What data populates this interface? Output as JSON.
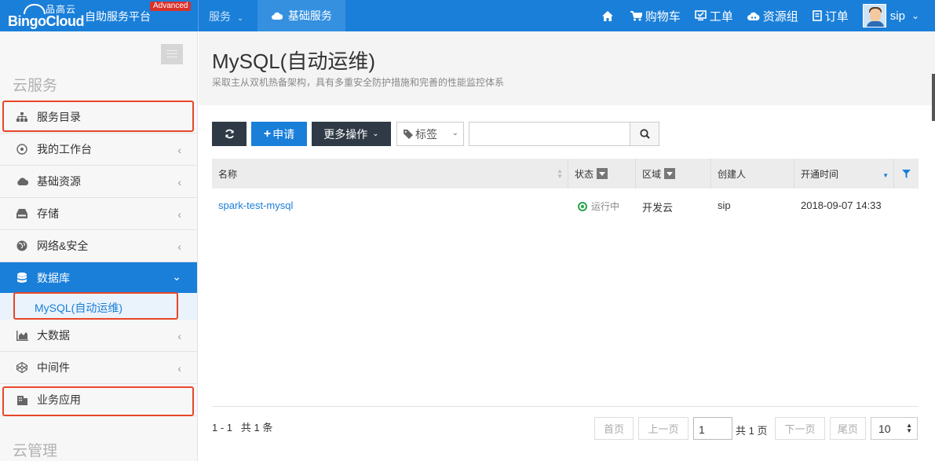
{
  "header": {
    "logo_cn": "品高云",
    "logo_en": "BingoCloud",
    "platform_title": "自助服务平台",
    "badge": "Advanced",
    "nav_services": "服务",
    "nav_basic": "基础服务",
    "cart": "购物车",
    "ticket": "工单",
    "resource_group": "资源组",
    "order": "订单",
    "user": "sip"
  },
  "sidebar": {
    "section_cloud_service": "云服务",
    "section_cloud_manage": "云管理",
    "items": [
      {
        "label": "服务目录",
        "icon": "sitemap-icon"
      },
      {
        "label": "我的工作台",
        "icon": "dashboard-icon"
      },
      {
        "label": "基础资源",
        "icon": "cloud-icon"
      },
      {
        "label": "存储",
        "icon": "storage-icon"
      },
      {
        "label": "网络&安全",
        "icon": "globe-icon"
      },
      {
        "label": "数据库",
        "icon": "database-icon"
      },
      {
        "label": "大数据",
        "icon": "chart-area-icon"
      },
      {
        "label": "中间件",
        "icon": "codepen-icon"
      },
      {
        "label": "业务应用",
        "icon": "building-icon"
      }
    ],
    "sub_item": "MySQL(自动运维)"
  },
  "page": {
    "title": "MySQL(自动运维)",
    "subtitle": "采取主从双机热备架构，具有多重安全防护措施和完善的性能监控体系"
  },
  "toolbar": {
    "apply": "申请",
    "more": "更多操作",
    "tag": "标签",
    "search_value": ""
  },
  "table": {
    "headers": {
      "name": "名称",
      "status": "状态",
      "region": "区域",
      "creator": "创建人",
      "time": "开通时间"
    },
    "rows": [
      {
        "name": "spark-test-mysql",
        "status": "运行中",
        "region": "开发云",
        "creator": "sip",
        "time": "2018-09-07 14:33"
      }
    ]
  },
  "pagination": {
    "range": "1 - 1",
    "total_items": "共 1 条",
    "first": "首页",
    "prev": "上一页",
    "page_value": "1",
    "total_pages": "共 1 页",
    "next": "下一页",
    "last": "尾页",
    "page_size": "10"
  },
  "colors": {
    "primary": "#1a7fd9",
    "dark_button": "#2f3a46",
    "highlight": "#e8462a",
    "running": "#2aa54b"
  }
}
